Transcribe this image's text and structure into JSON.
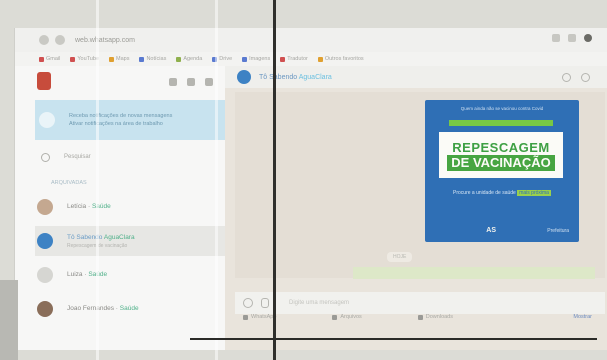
{
  "browser": {
    "url": "web.whatsapp.com",
    "bookmarks": [
      {
        "label": "Gmail",
        "color": "#d05050"
      },
      {
        "label": "YouTube",
        "color": "#d05050"
      },
      {
        "label": "Maps",
        "color": "#e0a030"
      },
      {
        "label": "Notícias",
        "color": "#5a7ad0"
      },
      {
        "label": "Agenda",
        "color": "#8fb04d"
      },
      {
        "label": "Drive",
        "color": "#5a7ad0"
      },
      {
        "label": "Imagens",
        "color": "#5a7ad0"
      },
      {
        "label": "Tradutor",
        "color": "#d05050"
      },
      {
        "label": "Outros favoritos",
        "color": "#e0a030"
      }
    ]
  },
  "sidebar": {
    "notice": {
      "title": "Receba notificações de novas mensagens",
      "subtitle": "Ativar notificações na área de trabalho"
    },
    "search_placeholder": "Pesquisar",
    "archived_label": "ARQUIVADAS",
    "chats": [
      {
        "name": "Letícia",
        "tag": "Saúde",
        "preview": "",
        "time": "",
        "avatar": "photo"
      },
      {
        "name": "Tô Sabendo",
        "tag": "AguaClara",
        "preview": "Repescagem de vacinação",
        "time": "",
        "avatar": "blue"
      },
      {
        "name": "Luiza",
        "tag": "Saúde",
        "preview": "",
        "time": "",
        "avatar": "gray"
      },
      {
        "name": "Joao Fernandes",
        "tag": "Saúde",
        "preview": "",
        "time": "",
        "avatar": "dark"
      }
    ]
  },
  "conversation": {
    "title": "Tô Sabendo",
    "tag": "AguaClara",
    "day_pill": "HOJE",
    "compose_placeholder": "Digite uma mensagem",
    "poster": {
      "top_text": "Quem ainda não se vacinou contra Covid",
      "headline_1": "REPESCAGEM",
      "headline_2": "DE VACINAÇÃO",
      "sub_text": "Procure a unidade de saúde",
      "sub_highlight": "mais próxima",
      "footer_left": "",
      "footer_logo": "AS",
      "footer_right": "Prefeitura",
      "time": ""
    }
  },
  "taskbar": {
    "items": [
      "WhatsApp",
      "Arquivos",
      "Downloads"
    ],
    "action": "Mostrar"
  },
  "colors": {
    "poster_blue": "#2f6fb5",
    "poster_green": "#47a542",
    "notice_bg": "#c8e3ef"
  }
}
